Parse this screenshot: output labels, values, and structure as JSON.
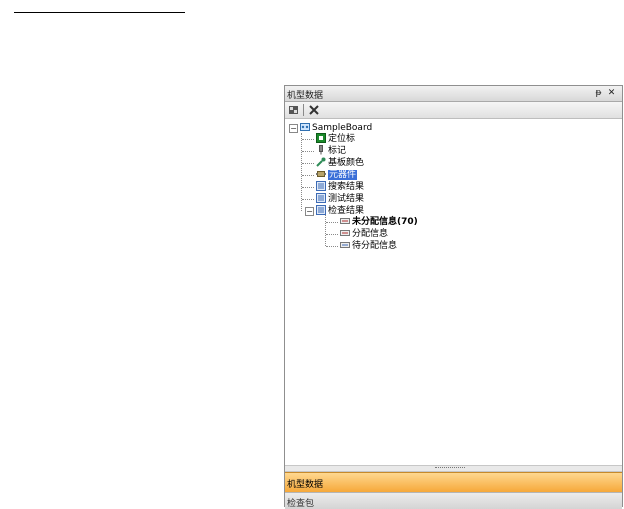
{
  "panel": {
    "title": "机型数据",
    "pin_glyph": "ᵽ",
    "close_glyph": "✕"
  },
  "toolbar": {
    "tools": [
      {
        "icon": "grid-icon"
      },
      {
        "icon": "tools-icon"
      }
    ]
  },
  "tree": {
    "root": {
      "label": "SampleBoard",
      "icon": "board-icon"
    },
    "items": [
      {
        "label": "定位标",
        "icon": "fiducial-icon",
        "color": "#1a8a2a"
      },
      {
        "label": "标记",
        "icon": "marker-icon",
        "color": "#666666"
      },
      {
        "label": "基板颜色",
        "icon": "color-picker-icon",
        "color": "#2e8b57"
      },
      {
        "label": "元器件",
        "icon": "component-icon",
        "color": "#7a6a3a"
      },
      {
        "label": "搜索结果",
        "icon": "list-icon",
        "color": "#3d6bb5"
      },
      {
        "label": "测试结果",
        "icon": "list-icon",
        "color": "#3d6bb5"
      },
      {
        "label": "检查结果",
        "icon": "list-icon",
        "color": "#3d6bb5"
      }
    ],
    "children": [
      {
        "label": "未分配信息(70)"
      },
      {
        "label": "分配信息"
      },
      {
        "label": "待分配信息"
      }
    ]
  },
  "tabs": {
    "active": "机型数据",
    "inactive": "检查包"
  }
}
